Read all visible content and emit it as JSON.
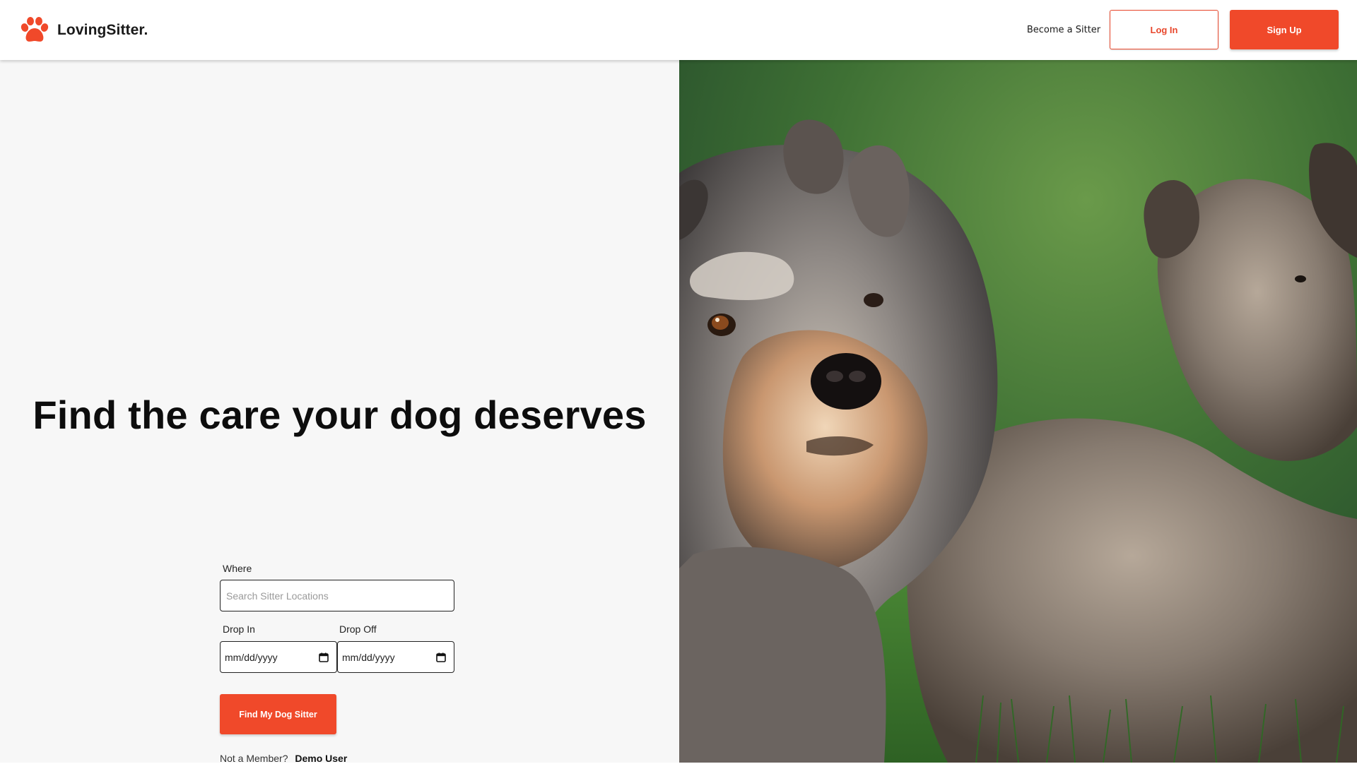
{
  "brand": {
    "name": "LovingSitter.",
    "logo_icon": "paw-icon",
    "accent_color": "#f0492a"
  },
  "nav": {
    "become_sitter": "Become a Sitter",
    "login": "Log In",
    "signup": "Sign Up"
  },
  "hero": {
    "headline": "Find the care your dog deserves",
    "photo": "two schnauzer dogs lying on grass"
  },
  "search_form": {
    "where_label": "Where",
    "where_placeholder": "Search Sitter Locations",
    "drop_in_label": "Drop In",
    "drop_in_value": "mm/dd/yyyy",
    "drop_off_label": "Drop Off",
    "drop_off_value": "mm/dd/yyyy",
    "calendar_icon": "calendar-icon",
    "submit": "Find My Dog Sitter"
  },
  "footer_prompt": {
    "text": "Not a Member?",
    "demo_link": "Demo User"
  }
}
